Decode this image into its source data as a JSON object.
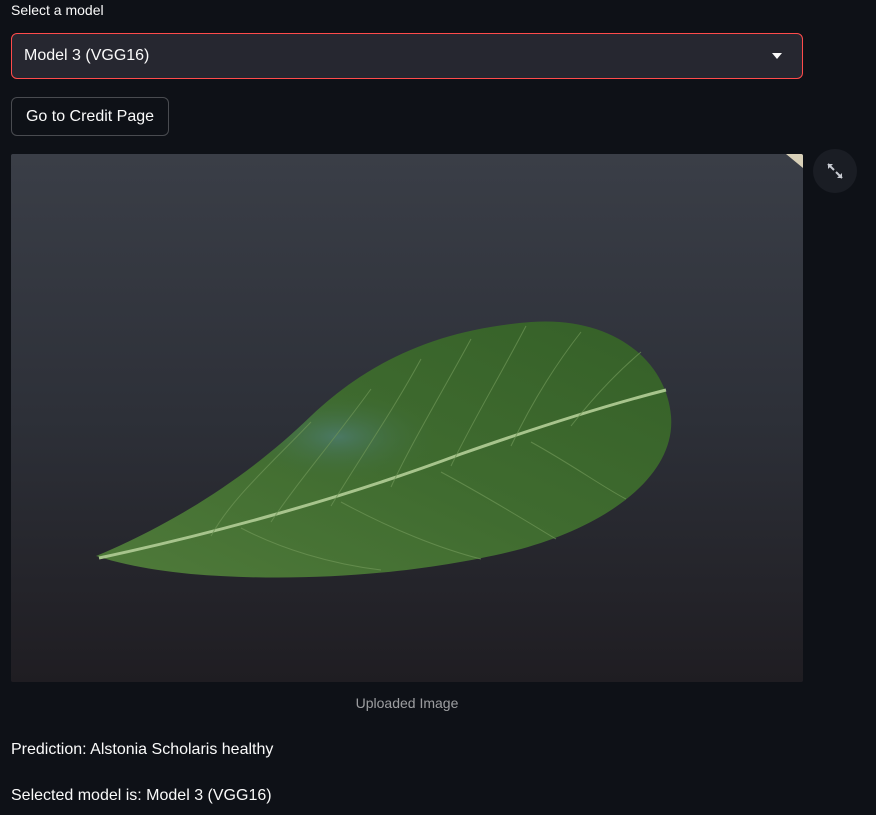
{
  "model_select": {
    "label": "Select a model",
    "value": "Model 3 (VGG16)",
    "accent_color": "#ff4b4b"
  },
  "credit_button": {
    "label": "Go to Credit Page"
  },
  "image": {
    "caption": "Uploaded Image",
    "fullscreen_icon": "expand-icon"
  },
  "results": {
    "prediction": "Prediction: Alstonia Scholaris healthy",
    "selected_model": "Selected model is: Model 3 (VGG16)"
  },
  "theme": {
    "background": "#0e1117",
    "text": "#fafafa",
    "input_bg": "#262730"
  }
}
